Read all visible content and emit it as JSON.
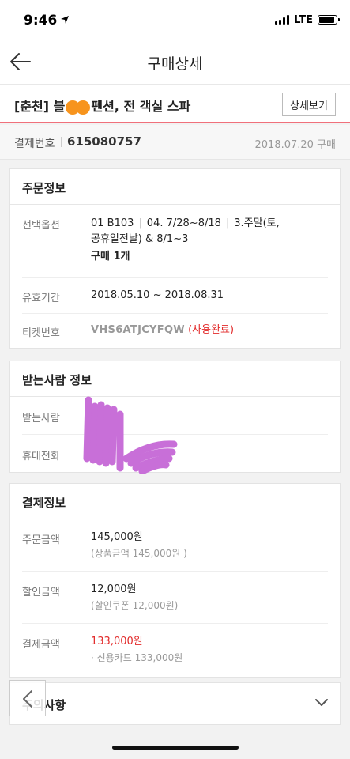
{
  "status": {
    "time": "9:46",
    "network": "LTE"
  },
  "nav": {
    "title": "구매상세"
  },
  "product": {
    "title_prefix": "[춘천] 블",
    "title_suffix": "펜션, 전 객실 스파",
    "detail_button": "상세보기"
  },
  "payment_number": {
    "label": "결제번호",
    "value": "615080757",
    "date": "2018.07.20 구매"
  },
  "order_info": {
    "header": "주문정보",
    "option_label": "선택옵션",
    "option_part1": "01 B103",
    "option_part2": "04. 7/28~8/18",
    "option_part3": "3.주말(토,",
    "option_line2": "공휴일전날) & 8/1~3",
    "quantity": "구매 1개",
    "validity_label": "유효기간",
    "validity_value": "2018.05.10 ~ 2018.08.31",
    "ticket_label": "티켓번호",
    "ticket_value": "VHS6ATJCYFQW",
    "ticket_status": "(사용완료)"
  },
  "recipient": {
    "header": "받는사람 정보",
    "name_label": "받는사람",
    "phone_label": "휴대전화"
  },
  "payment_info": {
    "header": "결제정보",
    "order_amount_label": "주문금액",
    "order_amount": "145,000원",
    "order_amount_sub": "(상품금액 145,000원 )",
    "discount_label": "할인금액",
    "discount_amount": "12,000원",
    "discount_sub": "(할인쿠폰 12,000원)",
    "paid_label": "결제금액",
    "paid_amount": "133,000원",
    "paid_sub": "· 신용카드 133,000원"
  },
  "notice": {
    "title": "주의사항"
  },
  "colors": {
    "accent_red": "#e22a2a",
    "divider_pink": "#f0707b",
    "redact_orange": "#f7941d",
    "redact_purple": "#c86fd8"
  }
}
